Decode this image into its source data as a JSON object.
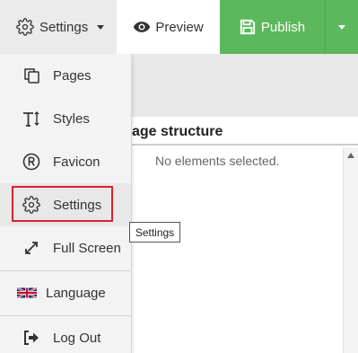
{
  "toolbar": {
    "settings_label": "Settings",
    "preview_label": "Preview",
    "publish_label": "Publish"
  },
  "panel": {
    "title": "age structure",
    "empty_text": "No elements selected."
  },
  "menu": {
    "items": [
      {
        "label": "Pages",
        "icon": "pages-icon"
      },
      {
        "label": "Styles",
        "icon": "text-size-icon"
      },
      {
        "label": "Favicon",
        "icon": "registered-icon"
      },
      {
        "label": "Settings",
        "icon": "gear-icon"
      },
      {
        "label": "Full Screen",
        "icon": "expand-icon"
      },
      {
        "label": "Language",
        "icon": "uk-flag-icon"
      },
      {
        "label": "Log Out",
        "icon": "logout-icon"
      }
    ]
  },
  "tooltip": {
    "text": "Settings"
  },
  "colors": {
    "publish": "#5cb85c",
    "highlight": "#d9232b"
  }
}
